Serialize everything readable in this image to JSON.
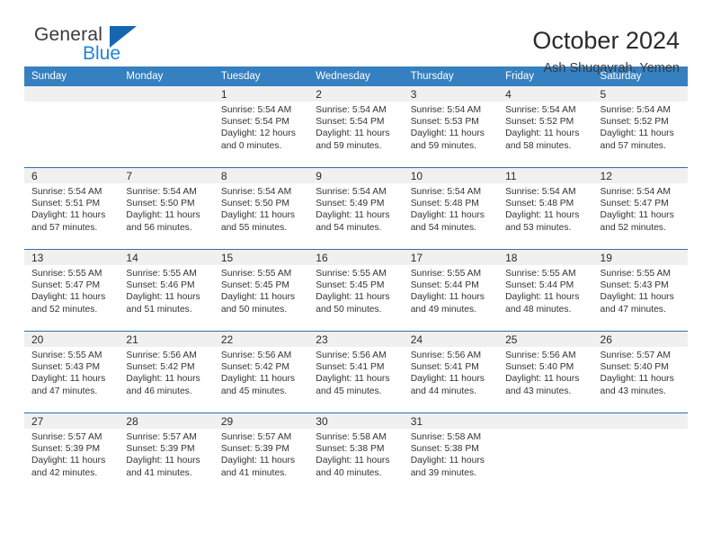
{
  "logo": {
    "part1": "General",
    "part2": "Blue",
    "triangle_color": "#1567b0",
    "blue_color": "#1f85d8"
  },
  "header": {
    "title": "October 2024",
    "subtitle": "Ash Shuqayrah, Yemen"
  },
  "theme": {
    "header_bg": "#3580c0",
    "daynum_bg": "#f0f0f0",
    "week_divider": "#2f6fa8"
  },
  "weekday_headers": [
    "Sunday",
    "Monday",
    "Tuesday",
    "Wednesday",
    "Thursday",
    "Friday",
    "Saturday"
  ],
  "weeks": [
    [
      {
        "day": "",
        "empty": true
      },
      {
        "day": "",
        "empty": true
      },
      {
        "day": "1",
        "sunrise": "Sunrise: 5:54 AM",
        "sunset": "Sunset: 5:54 PM",
        "daylight1": "Daylight: 12 hours",
        "daylight2": "and 0 minutes."
      },
      {
        "day": "2",
        "sunrise": "Sunrise: 5:54 AM",
        "sunset": "Sunset: 5:54 PM",
        "daylight1": "Daylight: 11 hours",
        "daylight2": "and 59 minutes."
      },
      {
        "day": "3",
        "sunrise": "Sunrise: 5:54 AM",
        "sunset": "Sunset: 5:53 PM",
        "daylight1": "Daylight: 11 hours",
        "daylight2": "and 59 minutes."
      },
      {
        "day": "4",
        "sunrise": "Sunrise: 5:54 AM",
        "sunset": "Sunset: 5:52 PM",
        "daylight1": "Daylight: 11 hours",
        "daylight2": "and 58 minutes."
      },
      {
        "day": "5",
        "sunrise": "Sunrise: 5:54 AM",
        "sunset": "Sunset: 5:52 PM",
        "daylight1": "Daylight: 11 hours",
        "daylight2": "and 57 minutes."
      }
    ],
    [
      {
        "day": "6",
        "sunrise": "Sunrise: 5:54 AM",
        "sunset": "Sunset: 5:51 PM",
        "daylight1": "Daylight: 11 hours",
        "daylight2": "and 57 minutes."
      },
      {
        "day": "7",
        "sunrise": "Sunrise: 5:54 AM",
        "sunset": "Sunset: 5:50 PM",
        "daylight1": "Daylight: 11 hours",
        "daylight2": "and 56 minutes."
      },
      {
        "day": "8",
        "sunrise": "Sunrise: 5:54 AM",
        "sunset": "Sunset: 5:50 PM",
        "daylight1": "Daylight: 11 hours",
        "daylight2": "and 55 minutes."
      },
      {
        "day": "9",
        "sunrise": "Sunrise: 5:54 AM",
        "sunset": "Sunset: 5:49 PM",
        "daylight1": "Daylight: 11 hours",
        "daylight2": "and 54 minutes."
      },
      {
        "day": "10",
        "sunrise": "Sunrise: 5:54 AM",
        "sunset": "Sunset: 5:48 PM",
        "daylight1": "Daylight: 11 hours",
        "daylight2": "and 54 minutes."
      },
      {
        "day": "11",
        "sunrise": "Sunrise: 5:54 AM",
        "sunset": "Sunset: 5:48 PM",
        "daylight1": "Daylight: 11 hours",
        "daylight2": "and 53 minutes."
      },
      {
        "day": "12",
        "sunrise": "Sunrise: 5:54 AM",
        "sunset": "Sunset: 5:47 PM",
        "daylight1": "Daylight: 11 hours",
        "daylight2": "and 52 minutes."
      }
    ],
    [
      {
        "day": "13",
        "sunrise": "Sunrise: 5:55 AM",
        "sunset": "Sunset: 5:47 PM",
        "daylight1": "Daylight: 11 hours",
        "daylight2": "and 52 minutes."
      },
      {
        "day": "14",
        "sunrise": "Sunrise: 5:55 AM",
        "sunset": "Sunset: 5:46 PM",
        "daylight1": "Daylight: 11 hours",
        "daylight2": "and 51 minutes."
      },
      {
        "day": "15",
        "sunrise": "Sunrise: 5:55 AM",
        "sunset": "Sunset: 5:45 PM",
        "daylight1": "Daylight: 11 hours",
        "daylight2": "and 50 minutes."
      },
      {
        "day": "16",
        "sunrise": "Sunrise: 5:55 AM",
        "sunset": "Sunset: 5:45 PM",
        "daylight1": "Daylight: 11 hours",
        "daylight2": "and 50 minutes."
      },
      {
        "day": "17",
        "sunrise": "Sunrise: 5:55 AM",
        "sunset": "Sunset: 5:44 PM",
        "daylight1": "Daylight: 11 hours",
        "daylight2": "and 49 minutes."
      },
      {
        "day": "18",
        "sunrise": "Sunrise: 5:55 AM",
        "sunset": "Sunset: 5:44 PM",
        "daylight1": "Daylight: 11 hours",
        "daylight2": "and 48 minutes."
      },
      {
        "day": "19",
        "sunrise": "Sunrise: 5:55 AM",
        "sunset": "Sunset: 5:43 PM",
        "daylight1": "Daylight: 11 hours",
        "daylight2": "and 47 minutes."
      }
    ],
    [
      {
        "day": "20",
        "sunrise": "Sunrise: 5:55 AM",
        "sunset": "Sunset: 5:43 PM",
        "daylight1": "Daylight: 11 hours",
        "daylight2": "and 47 minutes."
      },
      {
        "day": "21",
        "sunrise": "Sunrise: 5:56 AM",
        "sunset": "Sunset: 5:42 PM",
        "daylight1": "Daylight: 11 hours",
        "daylight2": "and 46 minutes."
      },
      {
        "day": "22",
        "sunrise": "Sunrise: 5:56 AM",
        "sunset": "Sunset: 5:42 PM",
        "daylight1": "Daylight: 11 hours",
        "daylight2": "and 45 minutes."
      },
      {
        "day": "23",
        "sunrise": "Sunrise: 5:56 AM",
        "sunset": "Sunset: 5:41 PM",
        "daylight1": "Daylight: 11 hours",
        "daylight2": "and 45 minutes."
      },
      {
        "day": "24",
        "sunrise": "Sunrise: 5:56 AM",
        "sunset": "Sunset: 5:41 PM",
        "daylight1": "Daylight: 11 hours",
        "daylight2": "and 44 minutes."
      },
      {
        "day": "25",
        "sunrise": "Sunrise: 5:56 AM",
        "sunset": "Sunset: 5:40 PM",
        "daylight1": "Daylight: 11 hours",
        "daylight2": "and 43 minutes."
      },
      {
        "day": "26",
        "sunrise": "Sunrise: 5:57 AM",
        "sunset": "Sunset: 5:40 PM",
        "daylight1": "Daylight: 11 hours",
        "daylight2": "and 43 minutes."
      }
    ],
    [
      {
        "day": "27",
        "sunrise": "Sunrise: 5:57 AM",
        "sunset": "Sunset: 5:39 PM",
        "daylight1": "Daylight: 11 hours",
        "daylight2": "and 42 minutes."
      },
      {
        "day": "28",
        "sunrise": "Sunrise: 5:57 AM",
        "sunset": "Sunset: 5:39 PM",
        "daylight1": "Daylight: 11 hours",
        "daylight2": "and 41 minutes."
      },
      {
        "day": "29",
        "sunrise": "Sunrise: 5:57 AM",
        "sunset": "Sunset: 5:39 PM",
        "daylight1": "Daylight: 11 hours",
        "daylight2": "and 41 minutes."
      },
      {
        "day": "30",
        "sunrise": "Sunrise: 5:58 AM",
        "sunset": "Sunset: 5:38 PM",
        "daylight1": "Daylight: 11 hours",
        "daylight2": "and 40 minutes."
      },
      {
        "day": "31",
        "sunrise": "Sunrise: 5:58 AM",
        "sunset": "Sunset: 5:38 PM",
        "daylight1": "Daylight: 11 hours",
        "daylight2": "and 39 minutes."
      },
      {
        "day": "",
        "empty": true
      },
      {
        "day": "",
        "empty": true
      }
    ]
  ]
}
